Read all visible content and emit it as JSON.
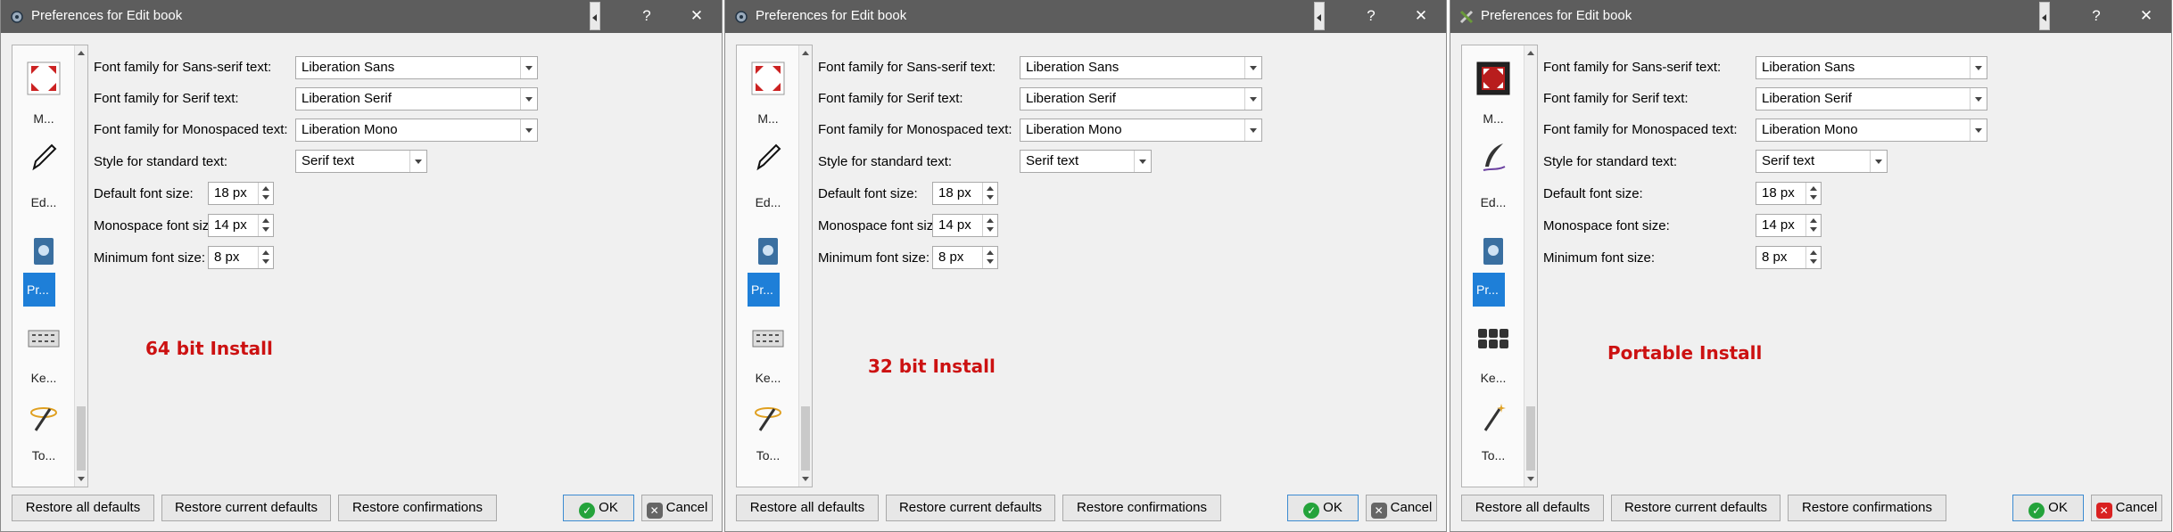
{
  "dialogs": [
    {
      "title": "Preferences for Edit book",
      "annotation": "64 bit Install",
      "sidebar": [
        "M...",
        "Ed...",
        "Pr...",
        "Ke...",
        "To..."
      ],
      "labels": {
        "sans": "Font family for Sans-serif text:",
        "serif": "Font family for Serif text:",
        "mono": "Font family for Monospaced text:",
        "style": "Style for standard text:",
        "default_size": "Default font size:",
        "mono_size": "Monospace font size:",
        "min_size": "Minimum font size:"
      },
      "values": {
        "sans": "Liberation Sans",
        "serif": "Liberation Serif",
        "mono": "Liberation Mono",
        "style": "Serif text",
        "default_size": "18 px",
        "mono_size": "14 px",
        "min_size": "8 px"
      },
      "buttons": {
        "restore_all": "Restore all defaults",
        "restore_current": "Restore current defaults",
        "restore_confirm": "Restore confirmations",
        "ok": "OK",
        "cancel": "Cancel"
      }
    },
    {
      "title": "Preferences for Edit book",
      "annotation": "32 bit Install",
      "sidebar": [
        "M...",
        "Ed...",
        "Pr...",
        "Ke...",
        "To..."
      ],
      "labels": {
        "sans": "Font family for Sans-serif text:",
        "serif": "Font family for Serif text:",
        "mono": "Font family for Monospaced text:",
        "style": "Style for standard text:",
        "default_size": "Default font size:",
        "mono_size": "Monospace font size:",
        "min_size": "Minimum font size:"
      },
      "values": {
        "sans": "Liberation Sans",
        "serif": "Liberation Serif",
        "mono": "Liberation Mono",
        "style": "Serif text",
        "default_size": "18 px",
        "mono_size": "14 px",
        "min_size": "8 px"
      },
      "buttons": {
        "restore_all": "Restore all defaults",
        "restore_current": "Restore current defaults",
        "restore_confirm": "Restore confirmations",
        "ok": "OK",
        "cancel": "Cancel"
      }
    },
    {
      "title": "Preferences for Edit book",
      "annotation": "Portable Install",
      "sidebar": [
        "M...",
        "Ed...",
        "Pr...",
        "Ke...",
        "To..."
      ],
      "labels": {
        "sans": "Font family for Sans-serif text:",
        "serif": "Font family for Serif text:",
        "mono": "Font family for Monospaced text:",
        "style": "Style for standard text:",
        "default_size": "Default font size:",
        "mono_size": "Monospace font size:",
        "min_size": "Minimum font size:"
      },
      "values": {
        "sans": "Liberation Sans",
        "serif": "Liberation Serif",
        "mono": "Liberation Mono",
        "style": "Serif text",
        "default_size": "18 px",
        "mono_size": "14 px",
        "min_size": "8 px"
      },
      "buttons": {
        "restore_all": "Restore all defaults",
        "restore_current": "Restore current defaults",
        "restore_confirm": "Restore confirmations",
        "ok": "OK",
        "cancel": "Cancel"
      }
    }
  ],
  "icons": {
    "titlebar": "app-settings-icon",
    "help": "?",
    "close": "✕"
  }
}
